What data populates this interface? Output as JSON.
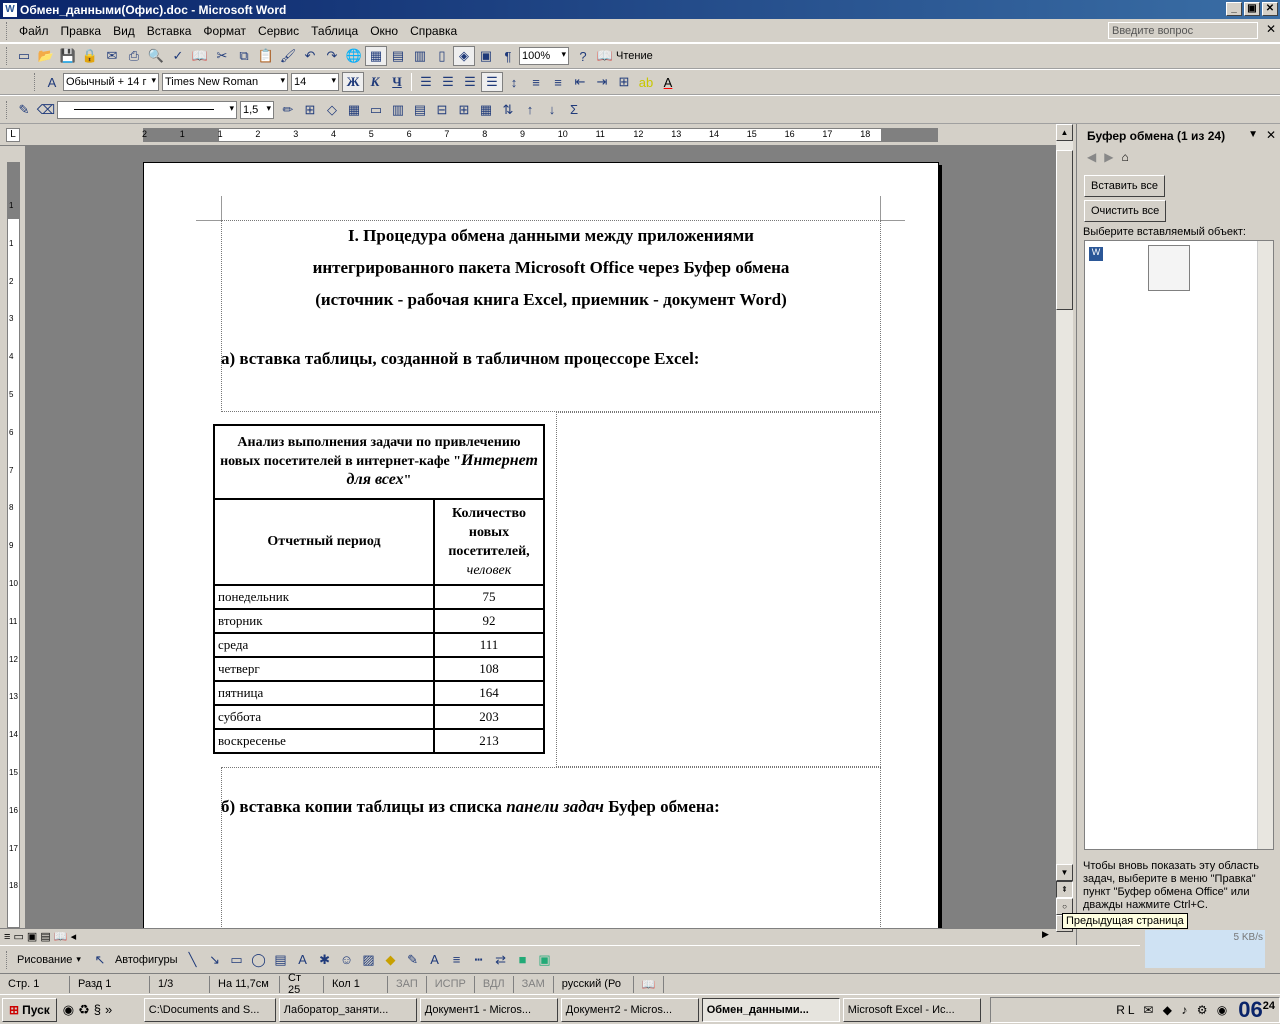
{
  "window": {
    "title": "Обмен_данными(Офис).doc - Microsoft Word",
    "min": "_",
    "max": "▣",
    "close": "✕"
  },
  "menu": [
    "Файл",
    "Правка",
    "Вид",
    "Вставка",
    "Формат",
    "Сервис",
    "Таблица",
    "Окно",
    "Справка"
  ],
  "ask_placeholder": "Введите вопрос",
  "toolbar": {
    "zoom": "100%",
    "reading": "Чтение",
    "style": "Обычный + 14 г",
    "font": "Times New Roman",
    "size": "14",
    "bold": "Ж",
    "italic": "К",
    "underline": "Ч",
    "line_weight": "1,5"
  },
  "ruler": {
    "h": [
      "2",
      "1",
      "1",
      "2",
      "3",
      "4",
      "5",
      "6",
      "7",
      "8",
      "9",
      "10",
      "11",
      "12",
      "13",
      "14",
      "15",
      "16",
      "17",
      "18"
    ],
    "v": [
      "1",
      "1",
      "2",
      "3",
      "4",
      "5",
      "6",
      "7",
      "8",
      "9",
      "10",
      "11",
      "12",
      "13",
      "14",
      "15",
      "16",
      "17",
      "18"
    ]
  },
  "document": {
    "heading_lines": [
      "I. Процедура обмена данными между приложениями",
      "интегрированного пакета Microsoft Office через Буфер обмена",
      "(источник - рабочая книга Excel, приемник - документ Word)"
    ],
    "section_a": "а) вставка таблицы, созданной в табличном процессоре Excel:",
    "table": {
      "title_plain": "Анализ выполнения задачи по привлечению новых посетителей в интернет-кафе \"",
      "title_italic": "Интернет для всех",
      "title_end": "\"",
      "col1": "Отчетный период",
      "col2": "Количество новых посетителей,",
      "col2_unit": "человек",
      "rows": [
        [
          "понедельник",
          "75"
        ],
        [
          "вторник",
          "92"
        ],
        [
          "среда",
          "111"
        ],
        [
          "четверг",
          "108"
        ],
        [
          "пятница",
          "164"
        ],
        [
          "суббота",
          "203"
        ],
        [
          "воскресенье",
          "213"
        ]
      ]
    },
    "section_b_start": "б) вставка копии таблицы из списка ",
    "section_b_italic": "панели задач",
    "section_b_end": " Буфер обмена:"
  },
  "taskpane": {
    "title": "Буфер обмена (1 из 24)",
    "paste_all": "Вставить все",
    "clear_all": "Очистить все",
    "choose": "Выберите вставляемый объект:",
    "hint": "Чтобы вновь показать эту область задач, выберите в меню \"Правка\" пункт \"Буфер обмена Office\" или дважды нажмите Ctrl+C.",
    "tooltip": "Предыдущая страница",
    "net": "5 KB/s"
  },
  "drawing": {
    "draw": "Рисование",
    "autoshapes": "Автофигуры"
  },
  "status": {
    "page": "Стр. 1",
    "section": "Разд 1",
    "pages": "1/3",
    "pos": "На 11,7см",
    "line": "Ст 25",
    "col": "Кол 1",
    "rec": "ЗАП",
    "trk": "ИСПР",
    "ext": "ВДЛ",
    "ovr": "ЗАМ",
    "lang": "русский (Ро"
  },
  "taskbar": {
    "start": "Пуск",
    "tasks": [
      "C:\\Documents and S...",
      "Лаборатор_заняти...",
      "Документ1 - Micros...",
      "Документ2 - Micros...",
      "Обмен_данными...",
      "Microsoft Excel - Ис..."
    ],
    "clock": "06",
    "clock_small": "24"
  }
}
